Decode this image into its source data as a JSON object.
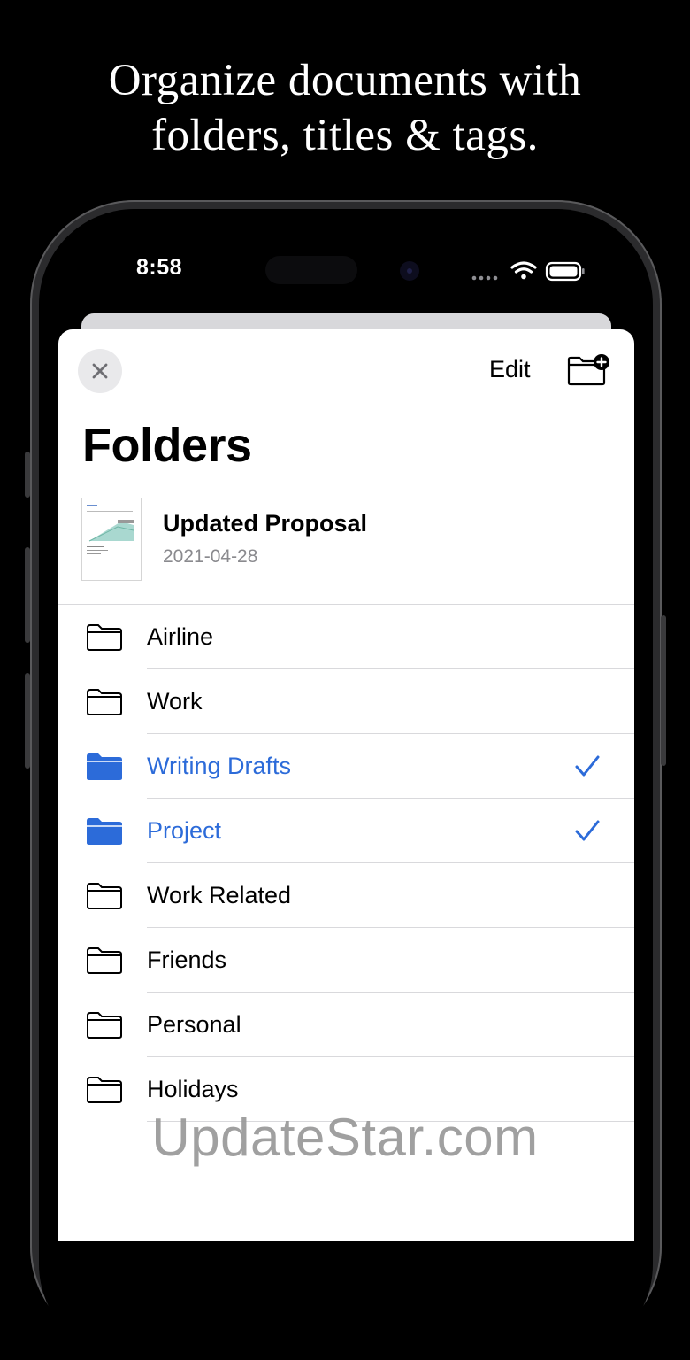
{
  "headline": {
    "line1": "Organize documents with",
    "line2": "folders, titles & tags."
  },
  "status_bar": {
    "time": "8:58"
  },
  "sheet": {
    "edit_label": "Edit",
    "title": "Folders",
    "document": {
      "name": "Updated Proposal",
      "date": "2021-04-28"
    }
  },
  "folders": [
    {
      "label": "Airline",
      "selected": false
    },
    {
      "label": "Work",
      "selected": false
    },
    {
      "label": "Writing Drafts",
      "selected": true
    },
    {
      "label": "Project",
      "selected": true
    },
    {
      "label": "Work Related",
      "selected": false
    },
    {
      "label": "Friends",
      "selected": false
    },
    {
      "label": "Personal",
      "selected": false
    },
    {
      "label": "Holidays",
      "selected": false
    }
  ],
  "watermark": "UpdateStar.com",
  "colors": {
    "accent": "#2c6bd9",
    "background": "#000000",
    "sheet": "#ffffff"
  },
  "icons": {
    "close": "close-icon",
    "add_folder": "folder-add-icon",
    "folder": "folder-icon",
    "check": "checkmark-icon"
  }
}
